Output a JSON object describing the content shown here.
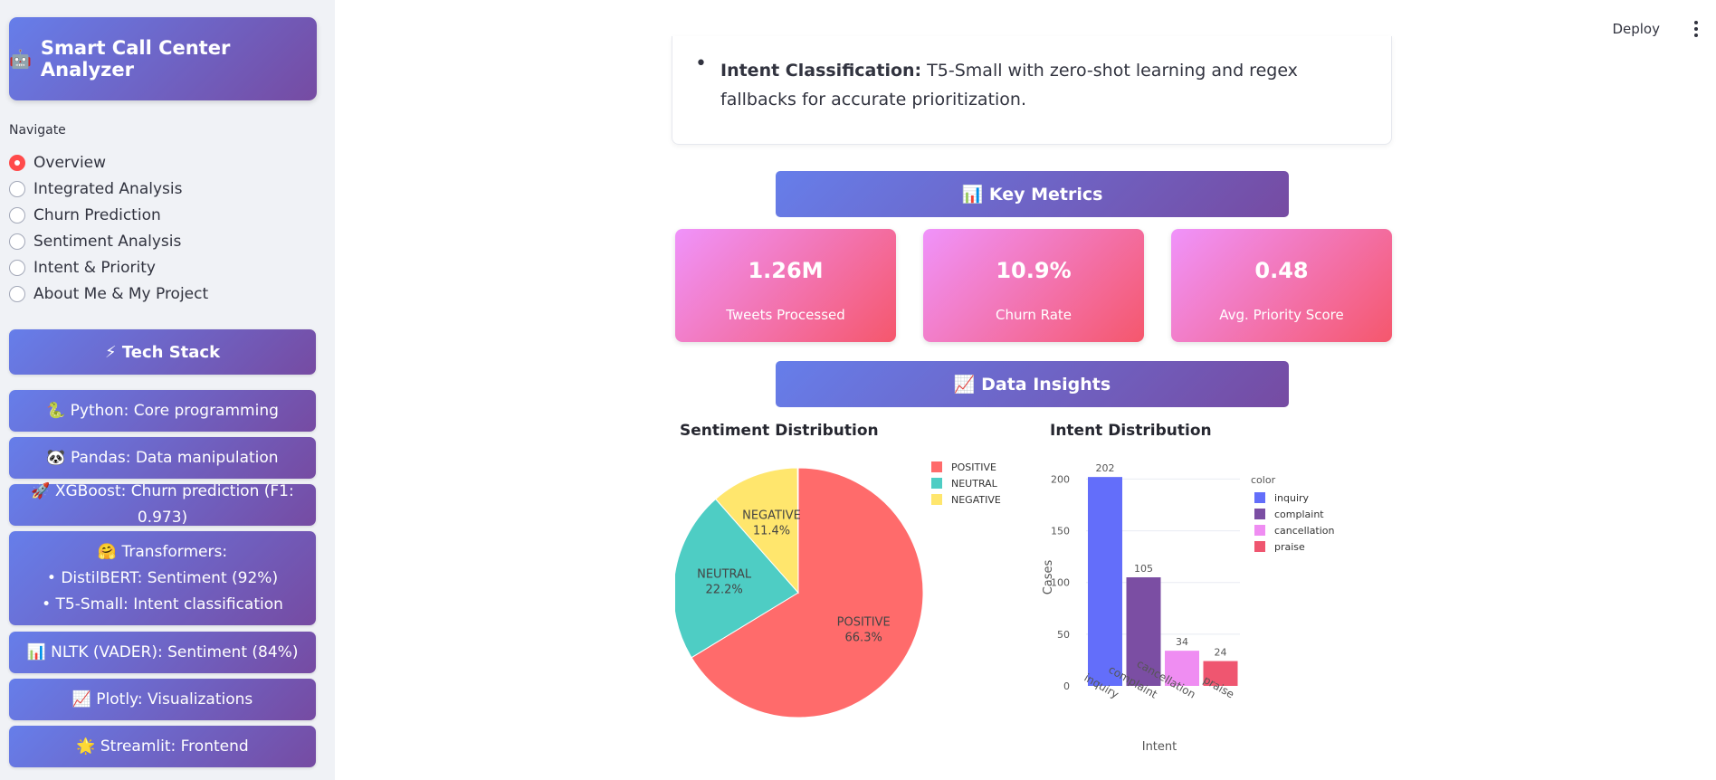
{
  "sidebar": {
    "app_title": "Smart Call Center Analyzer",
    "app_icon": "robot-icon",
    "nav_label": "Navigate",
    "nav_items": [
      {
        "label": "Overview",
        "selected": true
      },
      {
        "label": "Integrated Analysis",
        "selected": false
      },
      {
        "label": "Churn Prediction",
        "selected": false
      },
      {
        "label": "Sentiment Analysis",
        "selected": false
      },
      {
        "label": "Intent & Priority",
        "selected": false
      },
      {
        "label": "About Me & My Project",
        "selected": false
      }
    ],
    "tech_stack_title": "⚡ Tech Stack",
    "tech_items": [
      {
        "emoji": "🐍",
        "text": "Python: Core programming"
      },
      {
        "emoji": "🐼",
        "text": "Pandas: Data manipulation"
      },
      {
        "emoji": "🚀",
        "text": "XGBoost: Churn prediction (F1: 0.973)"
      },
      {
        "emoji": "🤗",
        "text": "Transformers:",
        "lines": [
          "• DistilBERT: Sentiment (92%)",
          "• T5-Small: Intent classification"
        ]
      },
      {
        "emoji": "📊",
        "text": "NLTK (VADER): Sentiment (84%)"
      },
      {
        "emoji": "📈",
        "text": "Plotly: Visualizations"
      },
      {
        "emoji": "🌟",
        "text": "Streamlit: Frontend"
      }
    ]
  },
  "header": {
    "deploy_label": "Deploy",
    "menu_icon": "kebab-menu-icon"
  },
  "intro": {
    "bullet_bold": "Intent Classification:",
    "bullet_text": " T5-Small with zero-shot learning and regex fallbacks for accurate prioritization."
  },
  "key_metrics": {
    "title": "📊 Key Metrics",
    "cards": [
      {
        "value": "1.26M",
        "label": "Tweets Processed"
      },
      {
        "value": "10.9%",
        "label": "Churn Rate"
      },
      {
        "value": "0.48",
        "label": "Avg. Priority Score"
      }
    ]
  },
  "data_insights": {
    "title": "📈 Data Insights"
  },
  "colors": {
    "accent_gradient_start": "#667eea",
    "accent_gradient_end": "#764ba2",
    "metric_gradient_start": "#f093fb",
    "metric_gradient_end": "#f5576c",
    "radio_selected": "#ff4b4b"
  },
  "chart_data": [
    {
      "type": "pie",
      "title": "Sentiment Distribution",
      "legend_position": "top-right",
      "slices": [
        {
          "label": "POSITIVE",
          "percent": 66.3,
          "color": "#ff6b6b"
        },
        {
          "label": "NEUTRAL",
          "percent": 22.2,
          "color": "#4ecdc4"
        },
        {
          "label": "NEGATIVE",
          "percent": 11.4,
          "color": "#ffe66d"
        }
      ]
    },
    {
      "type": "bar",
      "title": "Intent Distribution",
      "xlabel": "Intent",
      "ylabel": "Cases",
      "legend_title": "color",
      "legend_position": "right",
      "ylim": [
        0,
        210
      ],
      "yticks": [
        0,
        50,
        100,
        150,
        200
      ],
      "grid": true,
      "categories": [
        "inquiry",
        "complaint",
        "cancellation",
        "praise"
      ],
      "values": [
        202,
        105,
        34,
        24
      ],
      "colors": [
        "#636efa",
        "#7b4ea3",
        "#ef8df2",
        "#ef5670"
      ]
    }
  ]
}
